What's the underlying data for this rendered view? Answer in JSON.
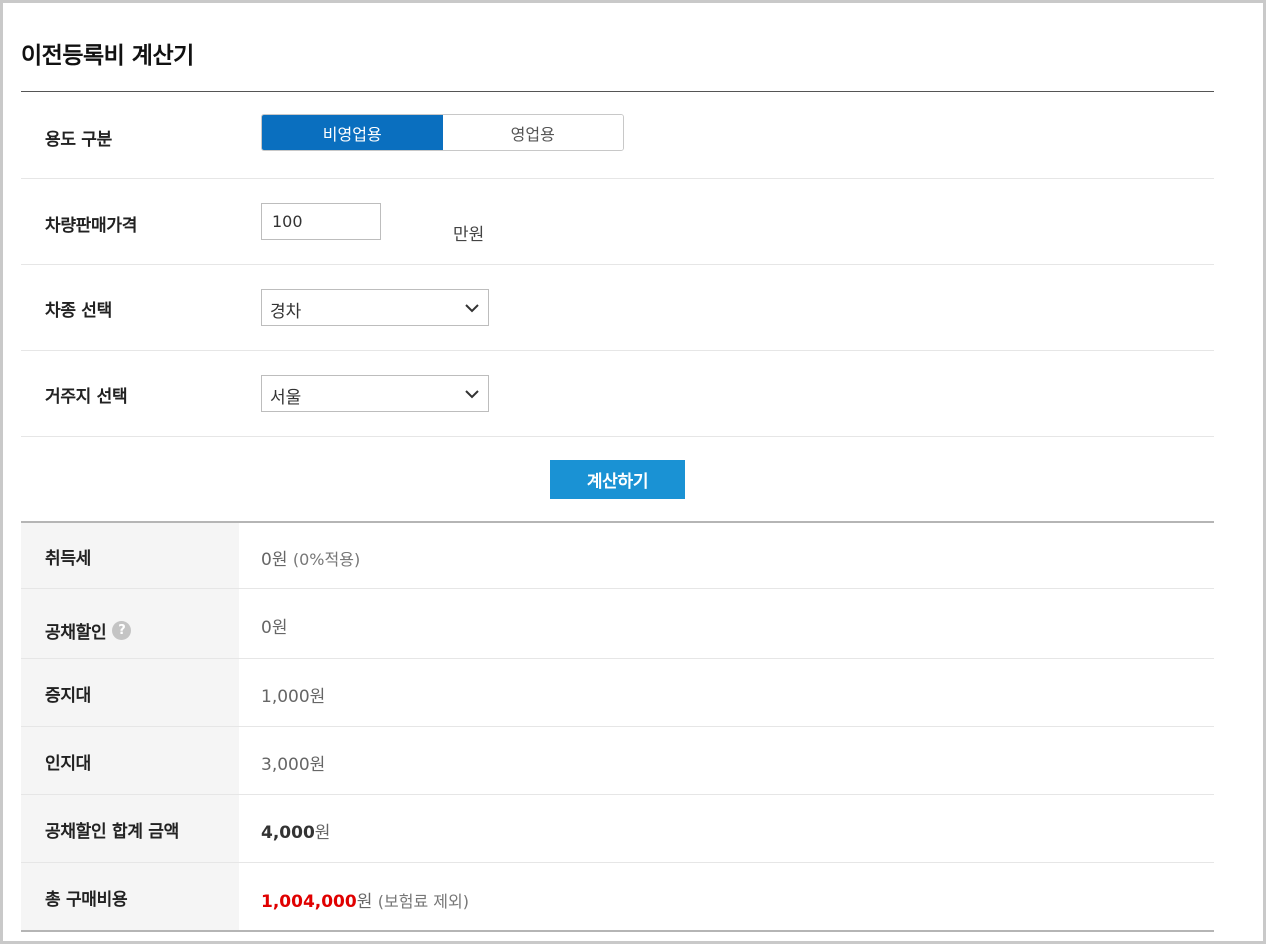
{
  "page": {
    "title": "이전등록비 계산기"
  },
  "form": {
    "usage": {
      "label": "용도 구분",
      "options": [
        "비영업용",
        "영업용"
      ],
      "selected": "비영업용"
    },
    "price": {
      "label": "차량판매가격",
      "value": "100",
      "unit": "만원"
    },
    "car_type": {
      "label": "차종 선택",
      "selected": "경차"
    },
    "residence": {
      "label": "거주지 선택",
      "selected": "서울"
    },
    "calculate_label": "계산하기"
  },
  "results": {
    "acquisition_tax": {
      "label": "취득세",
      "value": "0원",
      "note": "(0%적용)"
    },
    "bond_discount": {
      "label": "공채할인",
      "help_icon": "?",
      "value": "0원"
    },
    "certificate_fee": {
      "label": "증지대",
      "value": "1,000원"
    },
    "stamp_fee": {
      "label": "인지대",
      "value": "3,000원"
    },
    "bond_total": {
      "label": "공채할인 합계 금액",
      "amount": "4,000",
      "currency": "원"
    },
    "total": {
      "label": "총 구매비용",
      "amount": "1,004,000",
      "currency": "원",
      "note": "(보험료 제외)"
    }
  },
  "colors": {
    "accent": "#0a6fbf",
    "button": "#1a92d4",
    "highlight": "#e00000"
  }
}
